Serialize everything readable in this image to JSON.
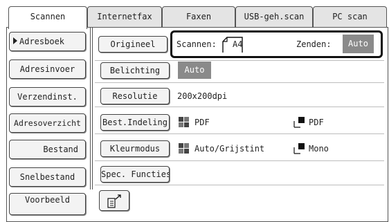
{
  "tabs": [
    {
      "label": "Scannen",
      "active": true
    },
    {
      "label": "Internetfax",
      "active": false
    },
    {
      "label": "Faxen",
      "active": false
    },
    {
      "label": "USB-geh.scan",
      "active": false
    },
    {
      "label": "PC scan",
      "active": false
    }
  ],
  "sidebar": {
    "items": [
      {
        "label": "Adresboek",
        "selected": true
      },
      {
        "label": "Adresinvoer"
      },
      {
        "label": "Verzendinst."
      },
      {
        "label": "Adresoverzicht"
      },
      {
        "label": "Bestand"
      },
      {
        "label": "Snelbestand"
      },
      {
        "label": "Voorbeeld"
      }
    ]
  },
  "settings": {
    "origineel": {
      "button": "Origineel",
      "scan_label": "Scannen:",
      "scan_value": "A4",
      "send_label": "Zenden:",
      "send_value": "Auto"
    },
    "belichting": {
      "button": "Belichting",
      "value": "Auto"
    },
    "resolutie": {
      "button": "Resolutie",
      "value": "200x200dpi"
    },
    "bestandsindeling": {
      "button": "Best.Indeling",
      "value_color": "PDF",
      "value_mono": "PDF"
    },
    "kleurmodus": {
      "button": "Kleurmodus",
      "value_color": "Auto/Grijstint",
      "value_mono": "Mono"
    },
    "spec_functies": {
      "button": "Spec. Functies"
    }
  },
  "colors": {
    "auto_badge": "#8a8a8a",
    "accent_black": "#111111"
  }
}
